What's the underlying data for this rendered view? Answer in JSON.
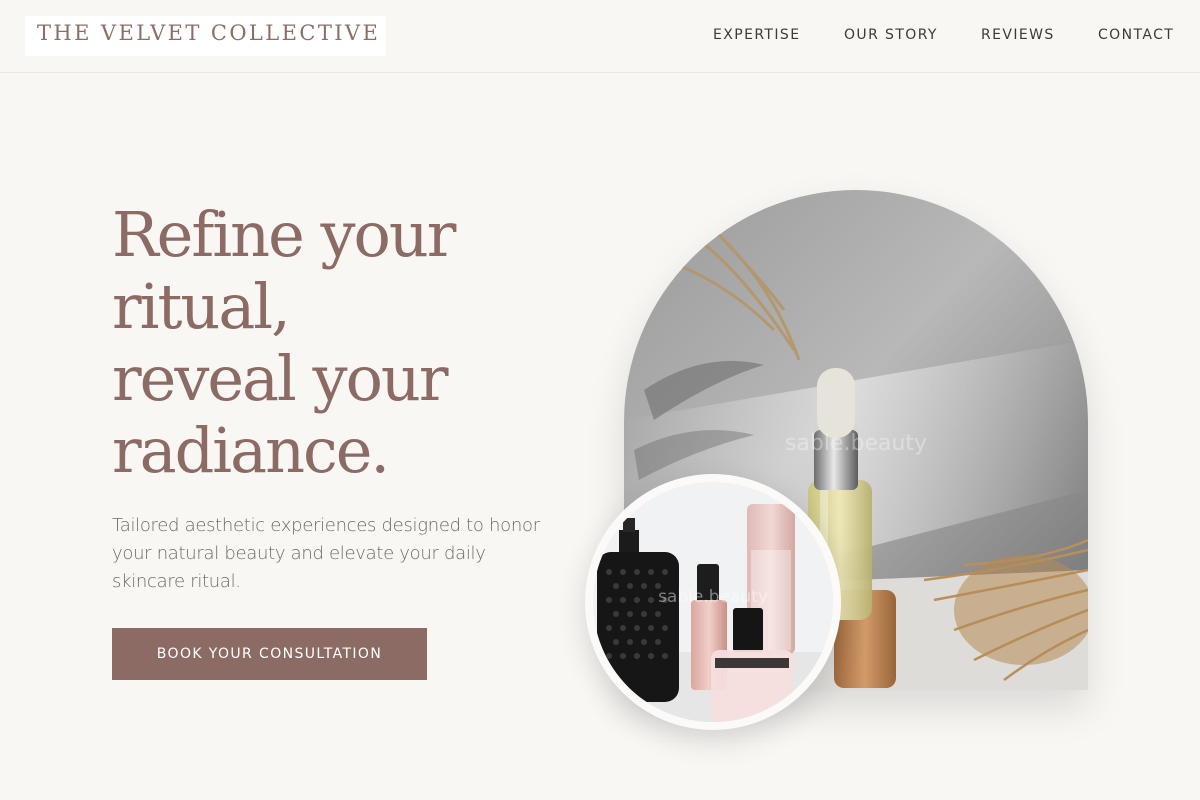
{
  "brand": {
    "name": "THE VELVET COLLECTIVE"
  },
  "nav": {
    "items": [
      {
        "label": "EXPERTISE"
      },
      {
        "label": "OUR STORY"
      },
      {
        "label": "REVIEWS"
      },
      {
        "label": "CONTACT"
      }
    ]
  },
  "hero": {
    "headline_lines": [
      "Refine your",
      "ritual,",
      "reveal your",
      "radiance."
    ],
    "subtext": "Tailored aesthetic experiences designed to honor your natural beauty and elevate your daily skincare ritual.",
    "cta_label": "BOOK YOUR CONSULTATION"
  },
  "images": {
    "arch_watermark": "sable.beauty",
    "circle_watermark": "sable.beauty"
  },
  "colors": {
    "accent": "#8b6b63",
    "background": "#f9f7f4",
    "nav_text": "#3d3a38",
    "body_text": "#6f6966"
  }
}
